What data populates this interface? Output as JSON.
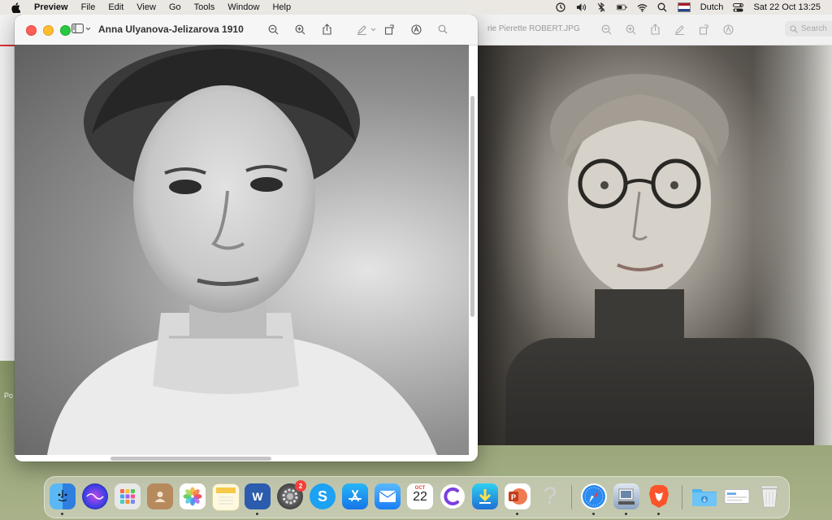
{
  "menubar": {
    "app_name": "Preview",
    "items": [
      "File",
      "Edit",
      "View",
      "Go",
      "Tools",
      "Window",
      "Help"
    ],
    "input_language": "Dutch",
    "clock": "Sat 22 Oct  13:25"
  },
  "background_window_right": {
    "title": "rie Pierette ROBERT.JPG",
    "search_placeholder": "Search"
  },
  "desktop": {
    "file_label": "Po"
  },
  "main_window": {
    "title": "Anna Ulyanova-Jelizarova 1910"
  },
  "dock": {
    "calendar_month": "OCT",
    "calendar_day": "22",
    "settings_badge": "2",
    "word_letter": "W",
    "skype_letter": "S",
    "question_mark": "?",
    "items": [
      {
        "name": "finder"
      },
      {
        "name": "siri"
      },
      {
        "name": "launchpad"
      },
      {
        "name": "contacts"
      },
      {
        "name": "photos"
      },
      {
        "name": "notes"
      },
      {
        "name": "microsoft-word"
      },
      {
        "name": "system-preferences"
      },
      {
        "name": "skype"
      },
      {
        "name": "app-store"
      },
      {
        "name": "mail"
      },
      {
        "name": "calendar"
      },
      {
        "name": "ccleaner"
      },
      {
        "name": "transmit"
      },
      {
        "name": "powerpoint"
      },
      {
        "name": "help"
      },
      {
        "name": "safari"
      },
      {
        "name": "preview"
      },
      {
        "name": "brave"
      },
      {
        "name": "downloads-folder"
      },
      {
        "name": "recent-window"
      },
      {
        "name": "trash"
      }
    ]
  }
}
